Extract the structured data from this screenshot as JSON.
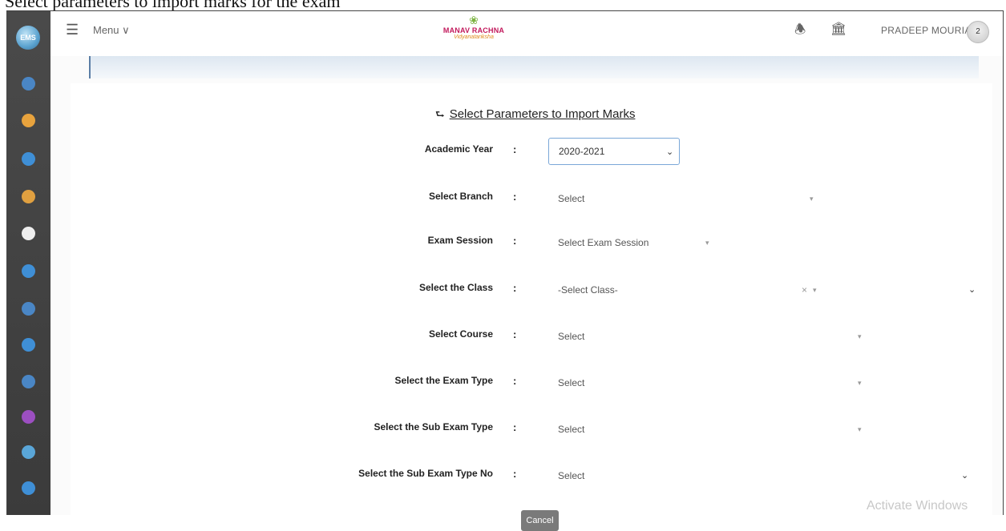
{
  "caption": "Select parameters to import marks for the exam",
  "header": {
    "menu_label": "Menu ∨",
    "brand_name": "MANAV RACHNA",
    "brand_tagline": "Vidyanatariksha",
    "username": "PRADEEP MOURIA",
    "avatar_badge": "2"
  },
  "rail": {
    "logo_text": "EMS",
    "icons": [
      {
        "name": "student-icon",
        "color": "#4a86c5"
      },
      {
        "name": "faculty-icon",
        "color": "#e8a33d"
      },
      {
        "name": "admission-icon",
        "color": "#3f8fd6"
      },
      {
        "name": "fee-icon",
        "color": "#e0a040"
      },
      {
        "name": "exam-icon",
        "color": "#eeeeee"
      },
      {
        "name": "staff-icon",
        "color": "#3f8fd6"
      },
      {
        "name": "classroom-icon",
        "color": "#4a86c5"
      },
      {
        "name": "report-icon",
        "color": "#3f8fd6"
      },
      {
        "name": "timetable-icon",
        "color": "#4a86c5"
      },
      {
        "name": "message-icon",
        "color": "#9c4fc1"
      },
      {
        "name": "institute-icon",
        "color": "#5aa6d8"
      },
      {
        "name": "network-icon",
        "color": "#3f8fd6"
      }
    ]
  },
  "form": {
    "heading": "Select Parameters to Import Marks",
    "rows": [
      {
        "label": "Academic Year",
        "value": "2020-2021"
      },
      {
        "label": "Select Branch",
        "value": "Select"
      },
      {
        "label": "Exam Session",
        "value": "Select Exam Session"
      },
      {
        "label": "Select the Class",
        "value": "-Select Class-"
      },
      {
        "label": "Select Course",
        "value": "Select"
      },
      {
        "label": "Select the Exam Type",
        "value": "Select"
      },
      {
        "label": "Select the Sub Exam Type",
        "value": "Select"
      },
      {
        "label": "Select the Sub Exam Type No",
        "value": "Select"
      }
    ],
    "cancel_label": "Cancel"
  },
  "watermark": "Activate Windows"
}
